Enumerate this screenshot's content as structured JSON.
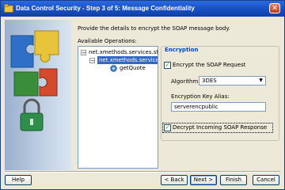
{
  "window": {
    "title": "Data Control Security - Step 3 of 5: Message Confidentiality",
    "close_glyph": "✕"
  },
  "content": {
    "description": "Provide the details to encrypt the SOAP message body.",
    "operations_label": "Available Operations:"
  },
  "tree": {
    "items": [
      {
        "label": "net.xmethods.services.stockquote",
        "expanded": true
      },
      {
        "label": "net.xmethods.services.s",
        "expanded": true,
        "selected": true
      },
      {
        "label": "getQuote",
        "icon": "operation-icon"
      }
    ]
  },
  "encryption": {
    "group_title": "Encryption",
    "encrypt_request_label": "Encrypt the SOAP Request",
    "encrypt_request_checked": true,
    "algorithm_label": "Algorithm:",
    "algorithm_value": "3DES",
    "key_alias_label": "Encryption Key Alias:",
    "key_alias_value": "serverencpublic",
    "decrypt_response_label": "Decrypt Incoming SOAP Response",
    "decrypt_response_checked": true
  },
  "buttons": {
    "help": "Help",
    "back": "< Back",
    "next": "Next >",
    "finish": "Finish",
    "cancel": "Cancel"
  },
  "colors": {
    "titlebar": "#0d3ea6",
    "group_title": "#0046d5",
    "selection": "#316ac5",
    "dialog_bg": "#ece9d8"
  }
}
